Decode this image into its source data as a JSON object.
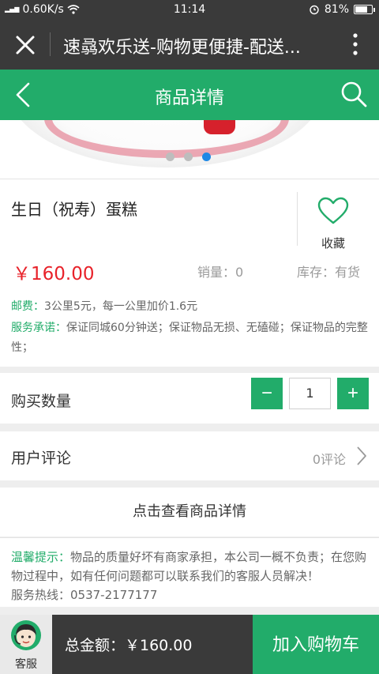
{
  "status_bar": {
    "signal": "4G 3G",
    "speed": "0.60K/s",
    "time": "11:14",
    "battery": "81%",
    "battery_level": 0.81
  },
  "browser": {
    "title": "速骉欢乐送-购物更便捷-配送..."
  },
  "app_bar": {
    "title": "商品详情"
  },
  "banner": {
    "slide_count": 3,
    "active_slide": 3
  },
  "product": {
    "name": "生日（祝寿）蛋糕",
    "favorite_label": "收藏",
    "price": "￥160.00",
    "sales": "销量：0",
    "stock": "库存：有货",
    "shipping_label": "邮费：",
    "shipping_text": "3公里5元，每一公里加价1.6元",
    "promise_label": "服务承诺：",
    "promise_text": "保证同城60分钟送；保证物品无损、无磕碰；保证物品的完整性；"
  },
  "quantity": {
    "label": "购买数量",
    "minus": "−",
    "value": "1",
    "plus": "+"
  },
  "reviews": {
    "label": "用户评论",
    "count": "0评论"
  },
  "details": {
    "label": "点击查看商品详情"
  },
  "notice": {
    "label": "温馨提示：",
    "text": "物品的质量好坏有商家承担，本公司一概不负责；在您购物过程中，如有任何问题都可以联系我们的客服人员解决！",
    "hotline": "服务热线：0537-2177177"
  },
  "bottom": {
    "service_label": "客服",
    "total": "总金额：￥160.00",
    "add_to_cart": "加入购物车"
  },
  "colors": {
    "accent": "#22ac6a",
    "dark": "#3a3a3a",
    "price": "#e8222a",
    "active_dot": "#1e88e5"
  },
  "icons": [
    "close-icon",
    "more-icon",
    "back-icon",
    "search-icon",
    "heart-icon",
    "chevron-right-icon",
    "service-avatar-icon",
    "wifi-icon",
    "alarm-icon",
    "battery-icon"
  ]
}
